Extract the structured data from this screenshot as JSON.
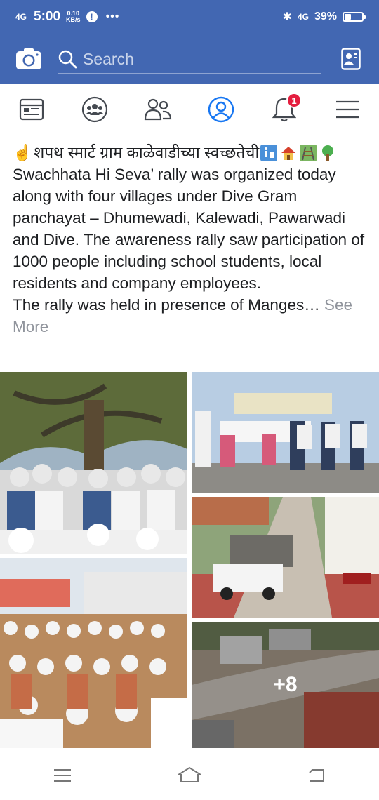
{
  "status_bar": {
    "signal": "4G",
    "time": "5:00",
    "speed_value": "0.10",
    "speed_unit": "KB/s",
    "network": "4G",
    "battery_percent": "39%",
    "battery_level": 0.39
  },
  "header": {
    "search_placeholder": "Search",
    "camera_icon": "camera-icon",
    "messenger_icon": "messenger-icon"
  },
  "tabs": [
    {
      "name": "news-feed",
      "icon": "news-feed-icon"
    },
    {
      "name": "groups",
      "icon": "groups-icon"
    },
    {
      "name": "friends",
      "icon": "friends-icon"
    },
    {
      "name": "profile",
      "icon": "profile-icon"
    },
    {
      "name": "notifications",
      "icon": "bell-icon",
      "badge": "1"
    },
    {
      "name": "menu",
      "icon": "hamburger-icon"
    }
  ],
  "post": {
    "marathi_title": "शपथ स्मार्ट ग्राम काळेवाडीच्या स्वच्छतेची",
    "body": "Swachhata Hi Seva’ rally was organized today along with four villages under Dive Gram panchayat – Dhumewadi, Kalewadi, Pawarwadi and Dive. The awareness rally saw participation of 1000 people including school students, local residents and company employees.",
    "body2": "The rally was held in presence of Manges…",
    "see_more": "See More"
  },
  "photos": {
    "more_count": "+8"
  },
  "colors": {
    "brand": "#4267b2",
    "badge": "#e41e3f",
    "active_tab": "#1877f2"
  }
}
